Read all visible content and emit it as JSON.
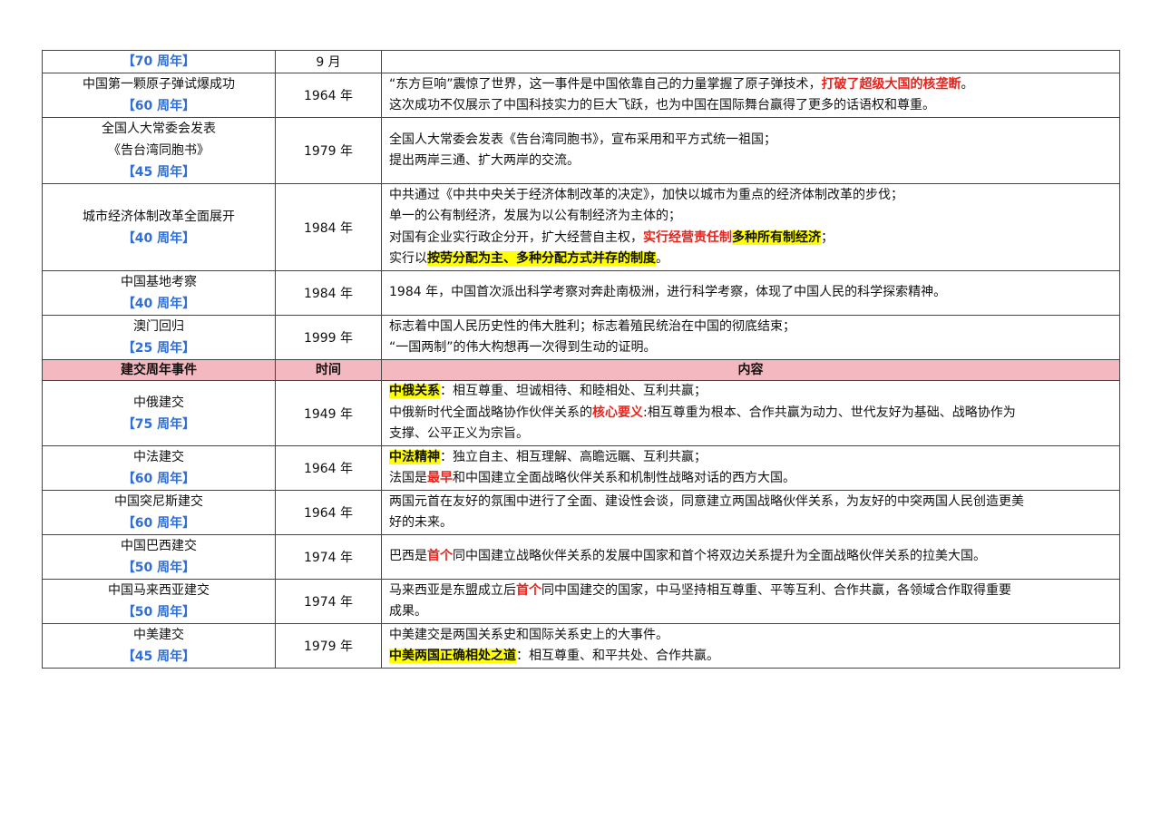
{
  "header": {
    "event": "建交周年事件",
    "time": "时间",
    "content": "内容"
  },
  "rows1": [
    {
      "name": "",
      "anniv": "【70 周年】",
      "year": "9 月",
      "lines": []
    },
    {
      "name": "中国第一颗原子弹试爆成功",
      "anniv": "【60 周年】",
      "year": "1964 年",
      "lines": [
        [
          {
            "t": "“东方巨响”震惊了世界，这一事件是中国依靠自己的力量掌握了原子弹技术，"
          },
          {
            "t": "打破了超级大国的核垄断",
            "s": "red"
          },
          {
            "t": "。"
          }
        ],
        [
          {
            "t": "这次成功不仅展示了中国科技实力的巨大飞跃，也为中国在国际舞台赢得了更多的话语权和尊重。"
          }
        ]
      ]
    },
    {
      "name": "全国人大常委会发表\n《告台湾同胞书》",
      "anniv": "【45 周年】",
      "year": "1979 年",
      "lines": [
        [
          {
            "t": "全国人大常委会发表《告台湾同胞书》，宣布采用和平方式统一祖国；"
          }
        ],
        [
          {
            "t": "提出两岸三通、扩大两岸的交流。"
          }
        ]
      ]
    },
    {
      "name": "城市经济体制改革全面展开",
      "anniv": "【40 周年】",
      "year": "1984 年",
      "lines": [
        [
          {
            "t": "中共通过《中共中央关于经济体制改革的决定》，加快以城市为重点的经济体制改革的步伐；"
          }
        ],
        [
          {
            "t": "单一的公有制经济，发展为以公有制经济为主体的；"
          }
        ],
        [
          {
            "t": "对国有企业实行政企分开，扩大经营自主权，"
          },
          {
            "t": "实行经营责任制",
            "s": "red"
          },
          {
            "t": "多种所有制经济",
            "s": "hl"
          },
          {
            "t": "；"
          }
        ],
        [
          {
            "t": "实行以"
          },
          {
            "t": "按劳分配为主、多种分配方式并存的制度",
            "s": "hl"
          },
          {
            "t": "。"
          }
        ]
      ]
    },
    {
      "name": "中国基地考察",
      "anniv": "【40 周年】",
      "year": "1984 年",
      "lines": [
        [
          {
            "t": "1984 年，中国首次派出科学考察对奔赴南极洲，进行科学考察，体现了中国人民的科学探索精神。"
          }
        ]
      ]
    },
    {
      "name": "澳门回归",
      "anniv": "【25 周年】",
      "year": "1999 年",
      "lines": [
        [
          {
            "t": "标志着中国人民历史性的伟大胜利；标志着殖民统治在中国的彻底结束；"
          }
        ],
        [
          {
            "t": "“一国两制”的伟大构想再一次得到生动的证明。"
          }
        ]
      ]
    }
  ],
  "rows2": [
    {
      "name": "中俄建交",
      "anniv": "【75 周年】",
      "year": "1949 年",
      "lines": [
        [
          {
            "t": "中俄关系",
            "s": "hl"
          },
          {
            "t": "：相互尊重、坦诚相待、和睦相处、互利共赢；"
          }
        ],
        [
          {
            "t": "中俄新时代全面战略协作伙伴关系的"
          },
          {
            "t": "核心要义",
            "s": "red"
          },
          {
            "t": ":相互尊重为根本、合作共赢为动力、世代友好为基础、战略协作为"
          }
        ],
        [
          {
            "t": "支撑、公平正义为宗旨。"
          }
        ]
      ]
    },
    {
      "name": "中法建交",
      "anniv": "【60 周年】",
      "year": "1964 年",
      "lines": [
        [
          {
            "t": "中法精神",
            "s": "hl"
          },
          {
            "t": "：独立自主、相互理解、高瞻远瞩、互利共赢；"
          }
        ],
        [
          {
            "t": "法国是"
          },
          {
            "t": "最早",
            "s": "red"
          },
          {
            "t": "和中国建立全面战略伙伴关系和机制性战略对话的西方大国。"
          }
        ]
      ]
    },
    {
      "name": "中国突尼斯建交",
      "anniv": "【60 周年】",
      "year": "1964 年",
      "lines": [
        [
          {
            "t": "两国元首在友好的氛围中进行了全面、建设性会谈，同意建立两国战略伙伴关系，为友好的中突两国人民创造更美"
          }
        ],
        [
          {
            "t": "好的未来。"
          }
        ]
      ]
    },
    {
      "name": "中国巴西建交",
      "anniv": "【50 周年】",
      "year": "1974 年",
      "lines": [
        [
          {
            "t": "巴西是"
          },
          {
            "t": "首个",
            "s": "red"
          },
          {
            "t": "同中国建立战略伙伴关系的发展中国家和首个将双边关系提升为全面战略伙伴关系的拉美大国。"
          }
        ]
      ]
    },
    {
      "name": "中国马来西亚建交",
      "anniv": "【50 周年】",
      "year": "1974 年",
      "lines": [
        [
          {
            "t": "马来西亚是东盟成立后"
          },
          {
            "t": "首个",
            "s": "red"
          },
          {
            "t": "同中国建交的国家，中马坚持相互尊重、平等互利、合作共赢，各领域合作取得重要"
          }
        ],
        [
          {
            "t": "成果。"
          }
        ]
      ]
    },
    {
      "name": "中美建交",
      "anniv": "【45 周年】",
      "year": "1979 年",
      "lines": [
        [
          {
            "t": "中美建交是两国关系史和国际关系史上的大事件。"
          }
        ],
        [
          {
            "t": "中美两国正确相处之道",
            "s": "hl"
          },
          {
            "t": "：相互尊重、和平共处、合作共赢。"
          }
        ]
      ]
    }
  ]
}
